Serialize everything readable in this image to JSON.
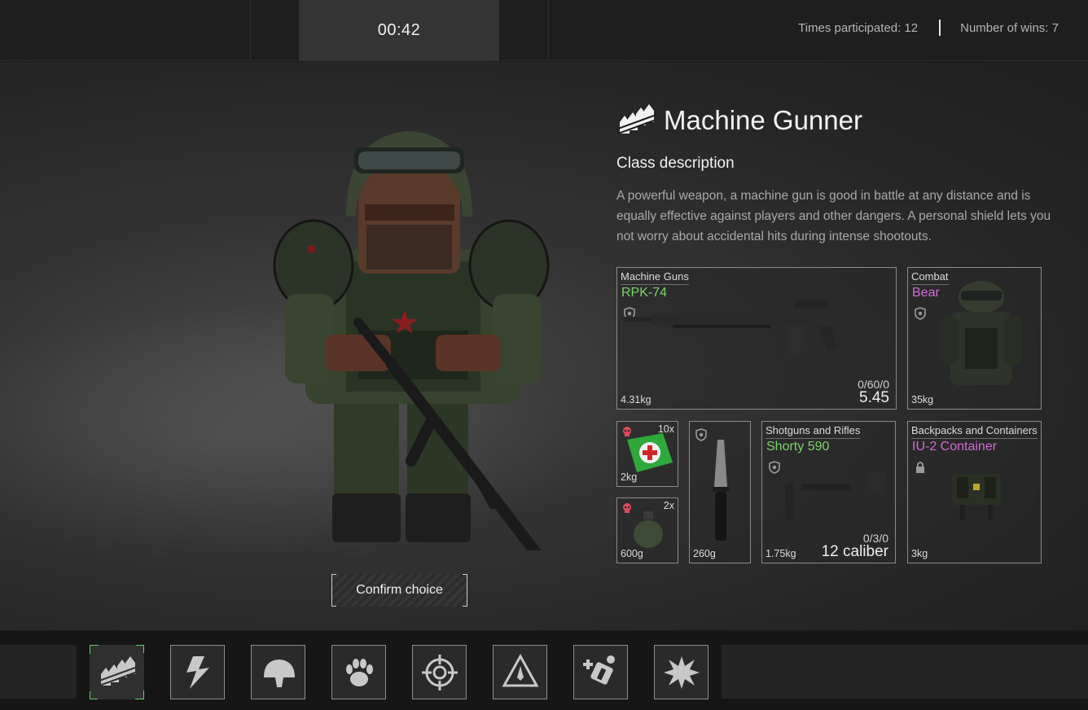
{
  "top_bar": {
    "timer": "00:42",
    "times_participated": "Times participated: 12",
    "number_of_wins": "Number of wins: 7"
  },
  "class_info": {
    "icon": "ammo-belt-icon",
    "name": "Machine Gunner",
    "description_heading": "Class description",
    "description": "A powerful weapon, a machine gun is good in battle at any distance and is equally effective against players and other dangers. A personal shield lets you not worry about accidental hits during intense shootouts."
  },
  "confirm_button": "Confirm choice",
  "loadout": {
    "primary": {
      "category": "Machine Guns",
      "name": "RPK-74",
      "weight": "4.31kg",
      "ammo": "0/60/0",
      "caliber": "5.45"
    },
    "armor": {
      "category": "Combat",
      "name": "Bear",
      "weight": "35kg"
    },
    "medkit": {
      "quantity": "10x",
      "weight": "2kg"
    },
    "grenade": {
      "quantity": "2x",
      "weight": "600g"
    },
    "knife": {
      "weight": "260g"
    },
    "secondary": {
      "category": "Shotguns and Rifles",
      "name": "Shorty 590",
      "weight": "1.75kg",
      "ammo": "0/3/0",
      "caliber": "12 caliber"
    },
    "container": {
      "category": "Backpacks and Containers",
      "name": "IU-2 Container",
      "weight": "3kg"
    }
  },
  "class_selector": [
    {
      "icon": "ammo-belt-icon",
      "selected": true
    },
    {
      "icon": "lightning-icon",
      "selected": false
    },
    {
      "icon": "helmet-icon",
      "selected": false
    },
    {
      "icon": "paw-icon",
      "selected": false
    },
    {
      "icon": "crosshair-icon",
      "selected": false
    },
    {
      "icon": "warning-triangle-icon",
      "selected": false
    },
    {
      "icon": "medic-icon",
      "selected": false
    },
    {
      "icon": "explosion-icon",
      "selected": false
    }
  ],
  "colors": {
    "item_name_weapon": "#7bd46a",
    "item_name_gear": "#d26ad8",
    "selection_accent": "#5fd36a"
  }
}
